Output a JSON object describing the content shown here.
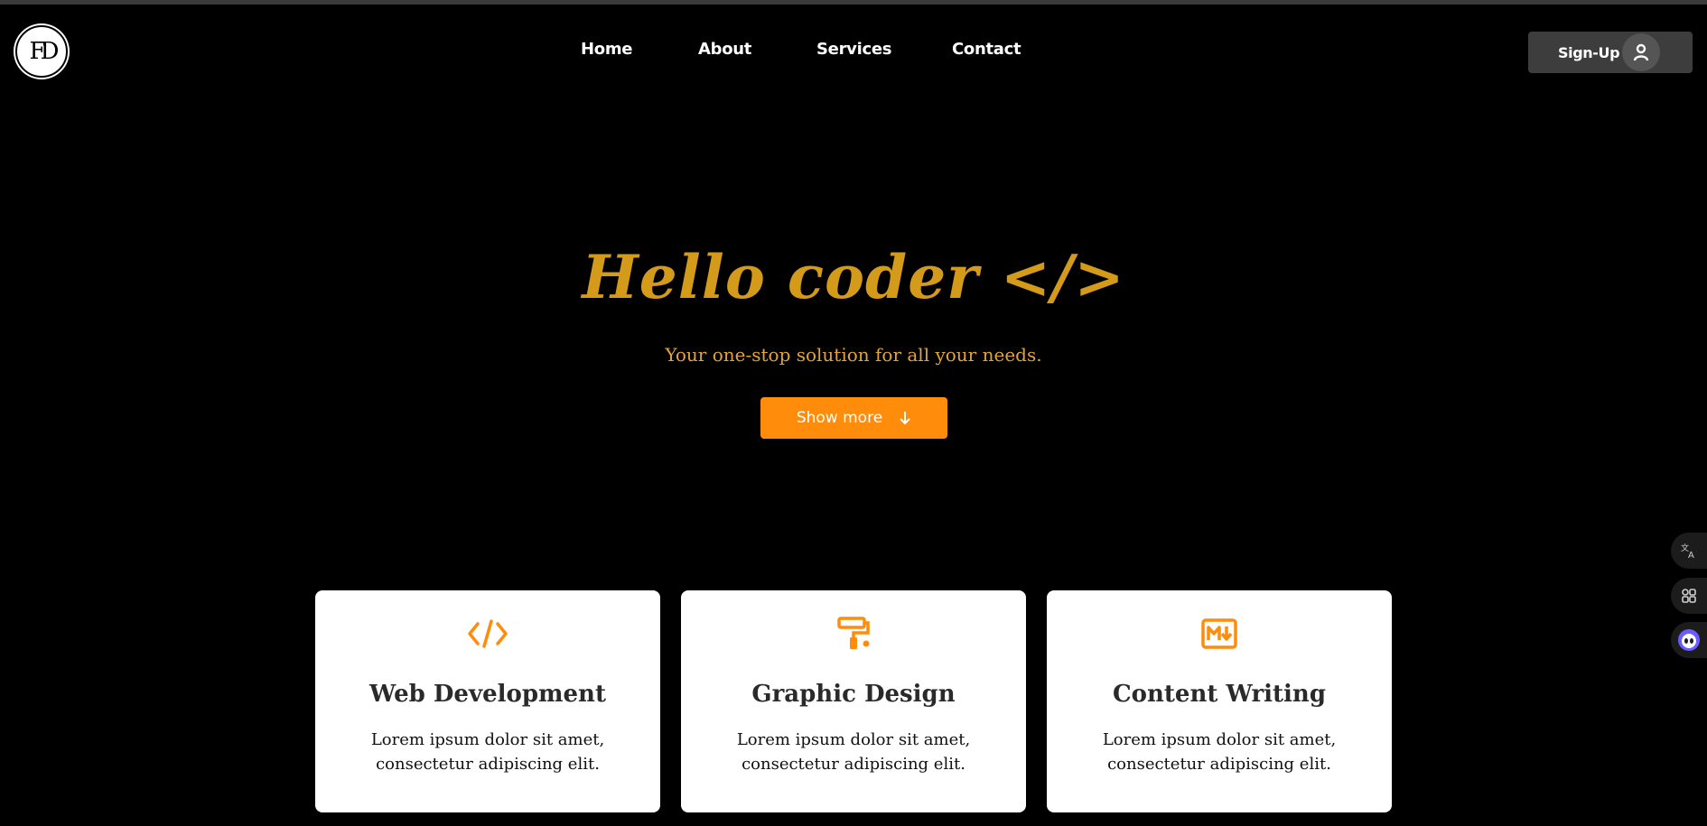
{
  "brand": {
    "logo_text": "FD"
  },
  "nav": {
    "items": [
      {
        "label": "Home"
      },
      {
        "label": "About"
      },
      {
        "label": "Services"
      },
      {
        "label": "Contact"
      }
    ]
  },
  "header": {
    "signup_label": "Sign-Up"
  },
  "hero": {
    "title": "Hello coder </>",
    "subtitle": "Your one-stop solution for all your needs.",
    "button_label": "Show more"
  },
  "services": [
    {
      "icon": "code-icon",
      "title": "Web Development",
      "text": "Lorem ipsum dolor sit amet, consectetur adipiscing elit."
    },
    {
      "icon": "paint-roller-icon",
      "title": "Graphic Design",
      "text": "Lorem ipsum dolor sit amet, consectetur adipiscing elit."
    },
    {
      "icon": "markdown-icon",
      "title": "Content Writing",
      "text": "Lorem ipsum dolor sit amet, consectetur adipiscing elit."
    }
  ],
  "side_tools": [
    {
      "icon": "translate-icon"
    },
    {
      "icon": "apps-grid-icon"
    },
    {
      "icon": "assistant-face-icon"
    }
  ],
  "colors": {
    "background": "#000000",
    "accent": "#ff8c0a",
    "hero_text": "#d49a1a",
    "card_bg": "#ffffff"
  }
}
